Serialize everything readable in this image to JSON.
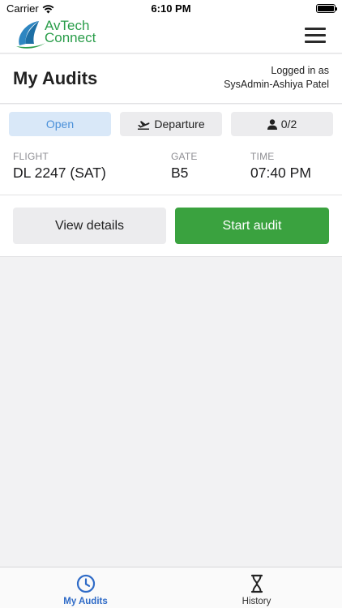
{
  "status_bar": {
    "carrier": "Carrier",
    "time": "6:10 PM",
    "battery_level": 1.0
  },
  "app_header": {
    "logo_line1": "AvTech",
    "logo_line2": "Connect",
    "menu_icon": "hamburger-menu-icon",
    "brand_color": "#2a9d4a"
  },
  "page_header": {
    "title": "My Audits",
    "logged_in_label": "Logged in as",
    "user_name": "SysAdmin-Ashiya Patel"
  },
  "audit": {
    "status": "Open",
    "direction": "Departure",
    "direction_icon": "plane-departure-icon",
    "crew_icon": "person-icon",
    "crew_count": "0/2",
    "flight_label": "FLIGHT",
    "flight_value": "DL 2247 (SAT)",
    "gate_label": "GATE",
    "gate_value": "B5",
    "time_label": "TIME",
    "time_value": "07:40 PM",
    "view_details_label": "View details",
    "start_audit_label": "Start audit",
    "start_color": "#3aa23f",
    "open_color": "#4a90d9"
  },
  "tab_bar": {
    "tabs": [
      {
        "label": "My Audits",
        "icon": "clock-icon",
        "active": true
      },
      {
        "label": "History",
        "icon": "hourglass-icon",
        "active": false
      }
    ]
  }
}
